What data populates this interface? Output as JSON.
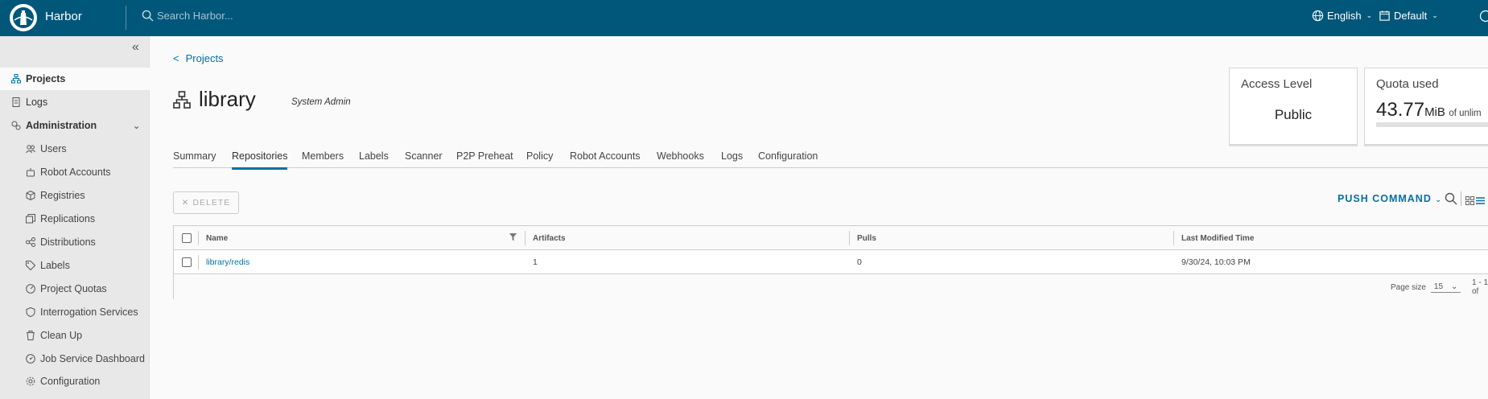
{
  "header": {
    "brand": "Harbor",
    "search_placeholder": "Search Harbor...",
    "language": "English",
    "theme": "Default"
  },
  "sidebar": {
    "items": [
      {
        "label": "Projects"
      },
      {
        "label": "Logs"
      },
      {
        "label": "Administration"
      },
      {
        "label": "Users"
      },
      {
        "label": "Robot Accounts"
      },
      {
        "label": "Registries"
      },
      {
        "label": "Replications"
      },
      {
        "label": "Distributions"
      },
      {
        "label": "Labels"
      },
      {
        "label": "Project Quotas"
      },
      {
        "label": "Interrogation Services"
      },
      {
        "label": "Clean Up"
      },
      {
        "label": "Job Service Dashboard"
      },
      {
        "label": "Configuration"
      }
    ]
  },
  "main": {
    "back_label": "Projects",
    "project_name": "library",
    "role": "System Admin",
    "access_card": {
      "label": "Access Level",
      "value": "Public"
    },
    "quota_card": {
      "label": "Quota used",
      "value": "43.77",
      "unit": "MiB",
      "suffix": "of unlim"
    },
    "tabs": [
      "Summary",
      "Repositories",
      "Members",
      "Labels",
      "Scanner",
      "P2P Preheat",
      "Policy",
      "Robot Accounts",
      "Webhooks",
      "Logs",
      "Configuration"
    ],
    "active_tab": "Repositories",
    "delete_label": "DELETE",
    "push_command_label": "PUSH COMMAND",
    "table": {
      "columns": [
        "Name",
        "Artifacts",
        "Pulls",
        "Last Modified Time"
      ],
      "rows": [
        {
          "name": "library/redis",
          "artifacts": "1",
          "pulls": "0",
          "modified": "9/30/24, 10:03 PM"
        }
      ],
      "page_size_label": "Page size",
      "page_size": "15",
      "range": "1 - 1 of"
    }
  }
}
